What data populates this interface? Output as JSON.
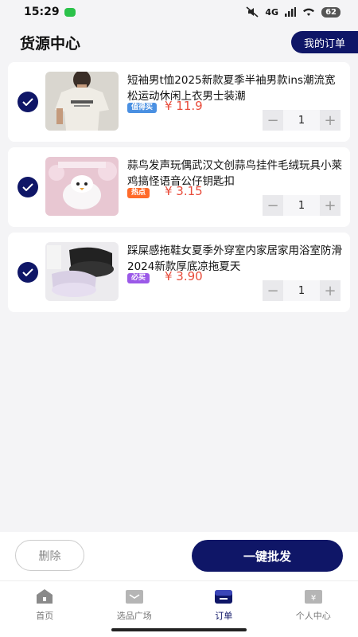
{
  "status": {
    "time": "15:29",
    "network": "4G",
    "battery": "62"
  },
  "header": {
    "title": "货源中心",
    "orders_label": "我的订单"
  },
  "products": [
    {
      "name": "短袖男t恤2025新款夏季半袖男款ins潮流宽松运动休闲上衣男士装潮",
      "tag": "值得买",
      "tag_color": "#4a90e2",
      "price": "¥ 11.9",
      "qty": "1"
    },
    {
      "name": "蒜鸟发声玩偶武汉文创蒜鸟挂件毛绒玩具小莱鸡搞怪语音公仔钥匙扣",
      "tag": "热点",
      "tag_color": "#ff6a2a",
      "price": "¥ 3.15",
      "qty": "1"
    },
    {
      "name": "踩屎感拖鞋女夏季外穿室内家居家用浴室防滑2024新款厚底凉拖夏天",
      "tag": "必买",
      "tag_color": "#9b59e8",
      "price": "¥ 3.90",
      "qty": "1"
    }
  ],
  "actions": {
    "delete_label": "删除",
    "batch_label": "一键批发"
  },
  "tabs": [
    {
      "label": "首页",
      "icon": "home-icon"
    },
    {
      "label": "选品广场",
      "icon": "mail-icon"
    },
    {
      "label": "订单",
      "icon": "order-icon"
    },
    {
      "label": "个人中心",
      "icon": "profile-icon"
    }
  ],
  "colors": {
    "accent": "#0f1667",
    "price": "#e84b3a"
  }
}
